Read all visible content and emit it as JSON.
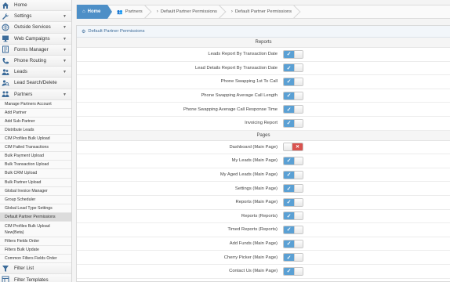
{
  "sidebar": {
    "main_items": [
      {
        "label": "Home",
        "icon": "home-icon",
        "chevron": false
      },
      {
        "label": "Settings",
        "icon": "wrench-icon",
        "chevron": true
      },
      {
        "label": "Outside Services",
        "icon": "globe-icon",
        "chevron": true
      },
      {
        "label": "Web Campaigns",
        "icon": "monitor-icon",
        "chevron": true
      },
      {
        "label": "Forms Manager",
        "icon": "form-icon",
        "chevron": true
      },
      {
        "label": "Phone Routing",
        "icon": "phone-icon",
        "chevron": true
      },
      {
        "label": "Leads",
        "icon": "users-icon",
        "chevron": true
      },
      {
        "label": "Lead Search/Delete",
        "icon": "search-user-icon",
        "chevron": false
      },
      {
        "label": "Partners",
        "icon": "partners-icon",
        "chevron": true
      }
    ],
    "sub_items": [
      "Manage Partners Account",
      "Add Partner",
      "Add Sub-Partner",
      "Distribute Leads",
      "CIM Profiles Bulk Upload",
      "CIM Failed Transactions",
      "Bulk Payment Upload",
      "Bulk Transaction Upload",
      "Bulk CRM Upload",
      "Bulk Partner Upload",
      "Global Invoice Manager",
      "Group Scheduler",
      "Global Lead Type Settings",
      "Default Partner Permissions",
      "CIM Profiles Bulk Upload New(Beta)",
      "Filters Fields Order",
      "Filters Bulk Update",
      "Common Filters Fields Order"
    ],
    "active_sub_index": 13,
    "bottom_items": [
      {
        "label": "Filter List",
        "icon": "filter-icon"
      },
      {
        "label": "Filter Templates",
        "icon": "template-icon"
      }
    ]
  },
  "breadcrumb": {
    "home": "Home",
    "items": [
      {
        "label": "Partners",
        "icon": "partners-icon"
      },
      {
        "label": "Default Partner Permissions",
        "icon": "arrow-icon"
      },
      {
        "label": "Default Partner Permissions",
        "icon": "arrow-icon"
      }
    ]
  },
  "panel": {
    "title": "Default Partner Permissions"
  },
  "sections": [
    {
      "title": "Reports",
      "rows": [
        {
          "label": "Leads Report By Transaction Date",
          "enabled": true
        },
        {
          "label": "Lead Details Report By Transaction Date",
          "enabled": true
        },
        {
          "label": "Phone Swapping 1st To Call",
          "enabled": true
        },
        {
          "label": "Phone Swapping Average Call Length",
          "enabled": true
        },
        {
          "label": "Phone Swapping Average Call Response Time",
          "enabled": true
        },
        {
          "label": "Invoicing Report",
          "enabled": true
        }
      ]
    },
    {
      "title": "Pages",
      "rows": [
        {
          "label": "Dashboard (Main Page)",
          "enabled": false
        },
        {
          "label": "My Leads (Main Page)",
          "enabled": true
        },
        {
          "label": "My Aged Leads (Main Page)",
          "enabled": true
        },
        {
          "label": "Settings (Main Page)",
          "enabled": true
        },
        {
          "label": "Reports (Main Page)",
          "enabled": true
        },
        {
          "label": "Reports (Reports)",
          "enabled": true
        },
        {
          "label": "Timed Reports (Reports)",
          "enabled": true
        },
        {
          "label": "Add Funds (Main Page)",
          "enabled": true
        },
        {
          "label": "Cherry Picker (Main Page)",
          "enabled": true
        },
        {
          "label": "Contact Us (Main Page)",
          "enabled": true
        }
      ]
    }
  ],
  "colors": {
    "accent": "#4d8fc7",
    "toggle_on": "#5aa0d4",
    "toggle_off": "#d9534f"
  }
}
